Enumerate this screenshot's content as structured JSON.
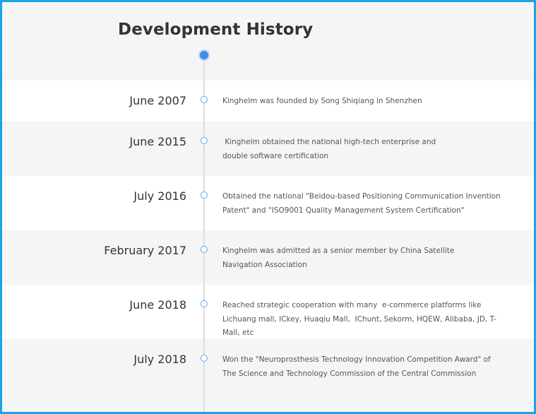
{
  "page": {
    "title": "Development History"
  },
  "timeline": [
    {
      "date": "June 2007",
      "text": "Kinghelm was founded by Song Shiqiang in Shenzhen"
    },
    {
      "date": "June 2015",
      "text": " Kinghelm obtained the national high-tech enterprise and double software certification"
    },
    {
      "date": "July 2016",
      "text": "Obtained the national \"Beidou-based Positioning Communication Invention Patent\" and \"ISO9001 Quality Management System Certification\""
    },
    {
      "date": "February 2017",
      "text": "Kinghelm was admitted as a senior member by China Satellite Navigation Association"
    },
    {
      "date": "June 2018",
      "text": "Reached strategic cooperation with many  e-commerce platforms like Lichuang mall, ICkey, Huaqiu Mall,  IChunt, Sekorm, HQEW, Alibaba, JD, T-Mall, etc"
    },
    {
      "date": "July 2018",
      "text": "Won the \"Neuroprosthesis Technology Innovation Competition Award\" of The Science and Technology Commission of the Central Commission"
    }
  ],
  "colors": {
    "border": "#1aa3e8",
    "accent": "#3d8fe8",
    "line": "#dcdcdc"
  }
}
